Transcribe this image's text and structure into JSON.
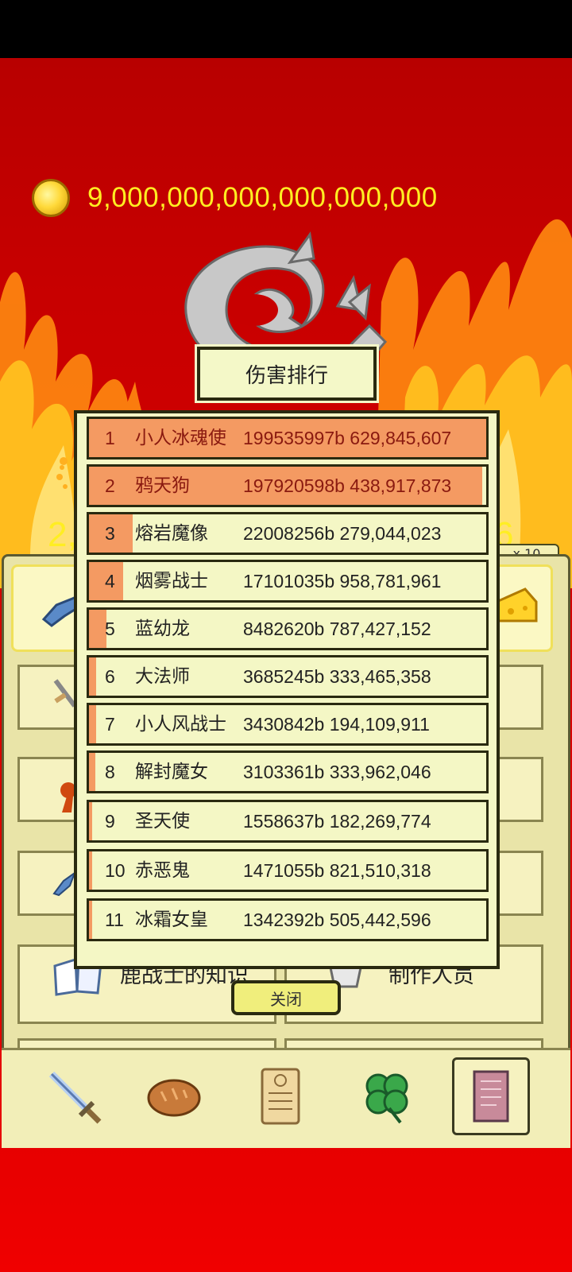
{
  "hud": {
    "coin_amount": "9,000,000,000,000,000,000",
    "side_left": "2,",
    "side_right": "6",
    "multiplier": "x 10"
  },
  "overlay": {
    "title": "伤害排行",
    "close_label": "关闭",
    "rows": [
      {
        "rank": "1",
        "name": "小人冰魂使",
        "score": "199535997b 629,845,607",
        "fill": 1.0
      },
      {
        "rank": "2",
        "name": "鸦天狗",
        "score": "197920598b 438,917,873",
        "fill": 0.99
      },
      {
        "rank": "3",
        "name": "熔岩魔像",
        "score": "22008256b 279,044,023",
        "fill": 0.11
      },
      {
        "rank": "4",
        "name": "烟雾战士",
        "score": "17101035b 958,781,961",
        "fill": 0.086
      },
      {
        "rank": "5",
        "name": "蓝幼龙",
        "score": "8482620b 787,427,152",
        "fill": 0.043
      },
      {
        "rank": "6",
        "name": "大法师",
        "score": "3685245b 333,465,358",
        "fill": 0.018
      },
      {
        "rank": "7",
        "name": "小人风战士",
        "score": "3430842b 194,109,911",
        "fill": 0.017
      },
      {
        "rank": "8",
        "name": "解封魔女",
        "score": "3103361b 333,962,046",
        "fill": 0.016
      },
      {
        "rank": "9",
        "name": "圣天使",
        "score": "1558637b 182,269,774",
        "fill": 0.008
      },
      {
        "rank": "10",
        "name": "赤恶鬼",
        "score": "1471055b 821,510,318",
        "fill": 0.007
      },
      {
        "rank": "11",
        "name": "冰霜女皇",
        "score": "1342392b 505,442,596",
        "fill": 0.007
      }
    ]
  },
  "menu": {
    "knowledge_label": "鹿战士的知识",
    "credits_label": "制作人员"
  },
  "nav": [
    "sword-icon",
    "bread-icon",
    "scroll-icon",
    "clover-icon",
    "book-icon"
  ],
  "colors": {
    "background_red": "#c80000",
    "coin_text": "#ffee22",
    "panel": "#e9e4a8",
    "rank_fill": "#f49a62"
  }
}
